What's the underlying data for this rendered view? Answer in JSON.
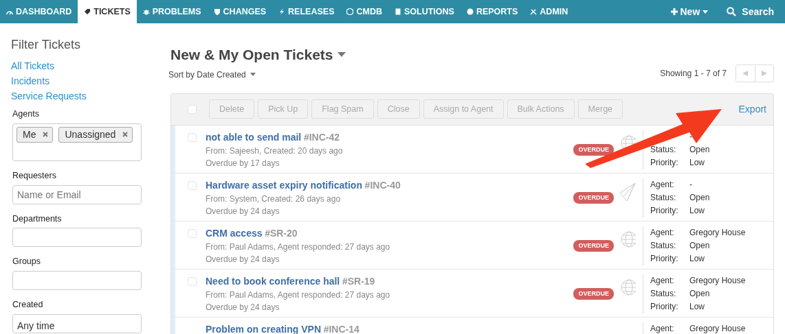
{
  "nav": {
    "items": [
      {
        "label": "DASHBOARD",
        "selected": false
      },
      {
        "label": "TICKETS",
        "selected": true
      },
      {
        "label": "PROBLEMS",
        "selected": false
      },
      {
        "label": "CHANGES",
        "selected": false
      },
      {
        "label": "RELEASES",
        "selected": false
      },
      {
        "label": "CMDB",
        "selected": false
      },
      {
        "label": "SOLUTIONS",
        "selected": false
      },
      {
        "label": "REPORTS",
        "selected": false
      },
      {
        "label": "ADMIN",
        "selected": false
      }
    ],
    "new_button": "New",
    "search_button": "Search"
  },
  "sidebar": {
    "title": "Filter Tickets",
    "links": [
      "All Tickets",
      "Incidents",
      "Service Requests"
    ],
    "filters": [
      {
        "kind": "tags",
        "label": "Agents",
        "tags": [
          "Me",
          "Unassigned"
        ]
      },
      {
        "kind": "input",
        "label": "Requesters",
        "placeholder": "Name or Email"
      },
      {
        "kind": "input",
        "label": "Departments"
      },
      {
        "kind": "input",
        "label": "Groups"
      },
      {
        "kind": "select",
        "label": "Created",
        "value": "Any time"
      }
    ]
  },
  "header": {
    "title": "New & My Open Tickets",
    "sort": "Sort by Date Created",
    "showing": "Showing 1 - 7 of 7"
  },
  "toolbar": {
    "select_all_checked": false,
    "buttons": [
      "Delete",
      "Pick Up",
      "Flag Spam",
      "Close",
      "Assign to Agent",
      "Bulk Actions",
      "Merge"
    ],
    "export": "Export"
  },
  "tickets": [
    {
      "title": "not able to send mail",
      "id": "#INC-42",
      "from": "From: Sajeesh, Created: 20 days ago",
      "due": "Overdue by 17 days",
      "badge": "OVERDUE",
      "kind": "portal",
      "checked": false,
      "agent": "-",
      "status_label": "Status:",
      "status": "Open",
      "priority_label": "Priority:",
      "priority": "Low"
    },
    {
      "title": "Hardware asset expiry notification",
      "id": "#INC-40",
      "from": "From: System, Created: 26 days ago",
      "due": "Overdue by 24 days",
      "badge": "OVERDUE",
      "kind": "email",
      "checked": false,
      "agent_label": "Agent:",
      "agent": "-",
      "status_label": "Status:",
      "status": "Open",
      "priority_label": "Priority:",
      "priority": "Low"
    },
    {
      "title": "CRM access",
      "id": "#SR-20",
      "from": "From: Paul Adams, Agent responded: 27 days ago",
      "due": "Overdue by 24 days",
      "badge": "OVERDUE",
      "kind": "portal",
      "checked": false,
      "agent_label": "Agent:",
      "agent": "Gregory House",
      "status_label": "Status:",
      "status": "Open",
      "priority_label": "Priority:",
      "priority": "Low"
    },
    {
      "title": "Need to book conference hall",
      "id": "#SR-19",
      "from": "From: Paul Adams, Agent responded: 27 days ago",
      "due": "Overdue by 24 days",
      "badge": "OVERDUE",
      "kind": "portal",
      "checked": false,
      "agent_label": "Agent:",
      "agent": "Gregory House",
      "status_label": "Status:",
      "status": "Open",
      "priority_label": "Priority:",
      "priority": "Low"
    },
    {
      "title": "Problem on creating VPN",
      "id": "#INC-14",
      "agent_label": "Agent:",
      "agent": "Gregory House"
    }
  ]
}
